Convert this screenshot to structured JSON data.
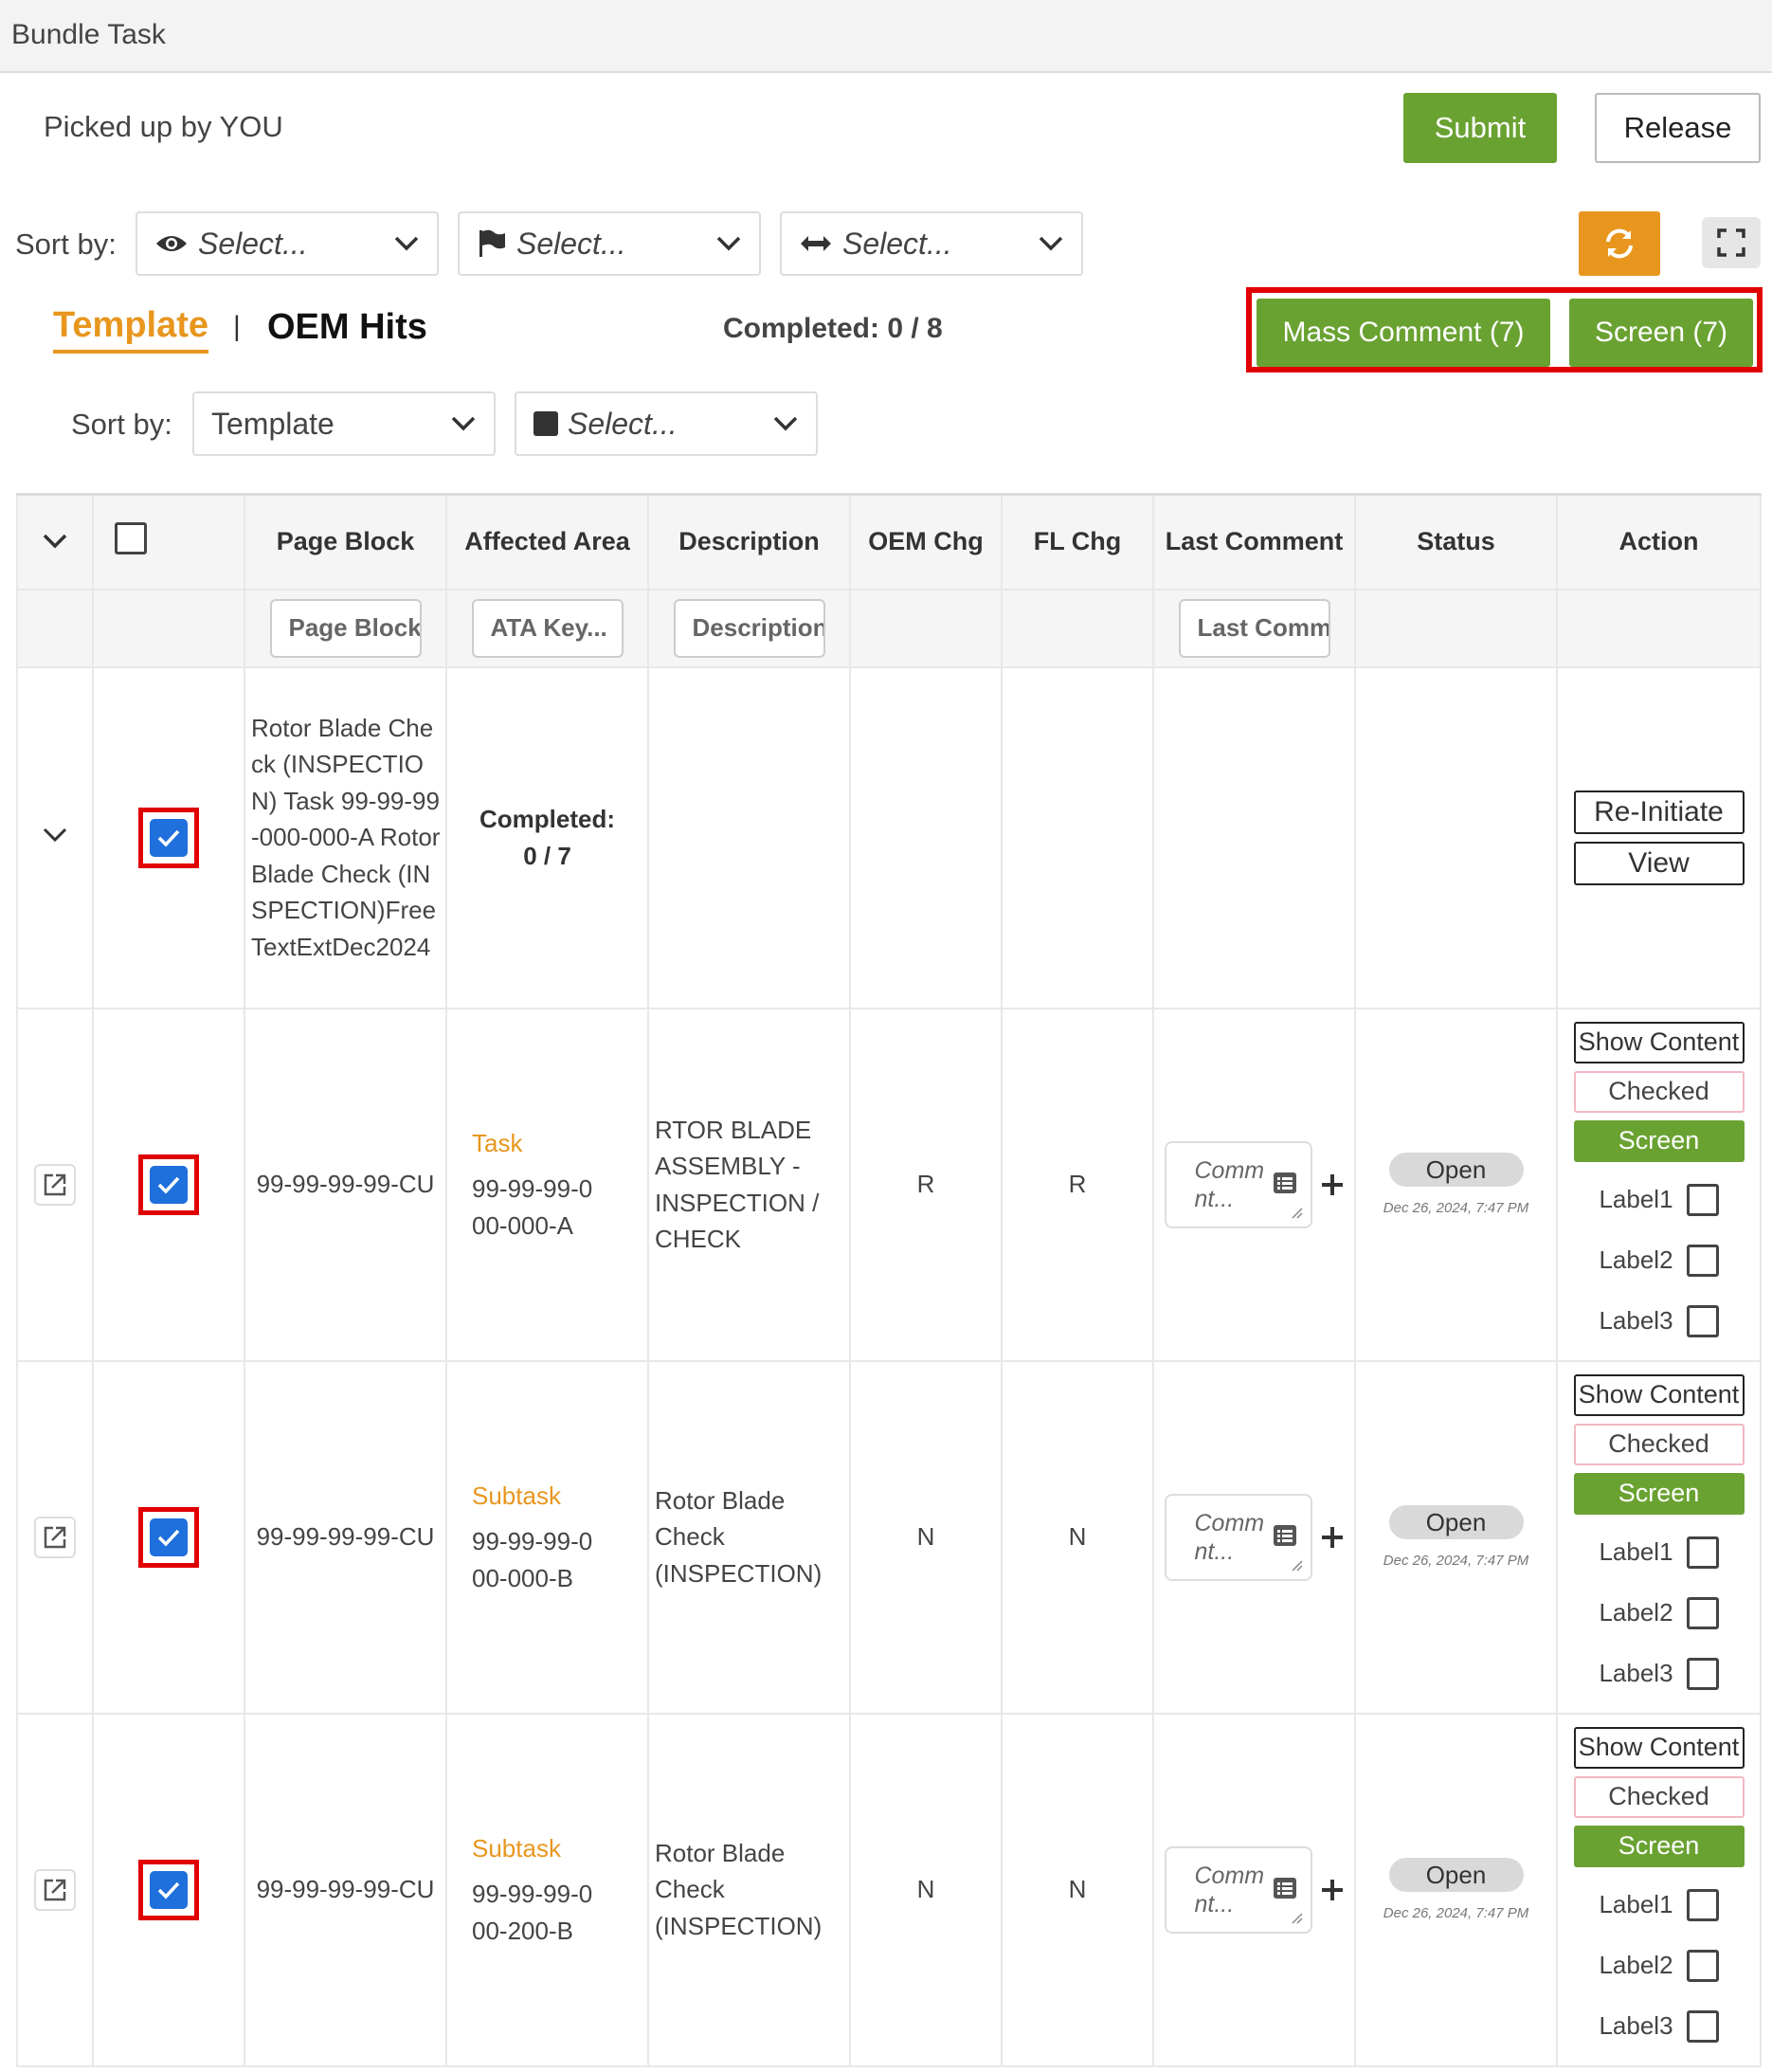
{
  "window": {
    "title": "Bundle Task"
  },
  "header": {
    "picked_up": "Picked up by YOU",
    "submit_label": "Submit",
    "release_label": "Release"
  },
  "sort1": {
    "label": "Sort by:",
    "select1": "Select...",
    "select2": "Select...",
    "select3": "Select..."
  },
  "tabs": {
    "template": "Template",
    "separator": "|",
    "oem_hits": "OEM Hits",
    "completed": "Completed: 0 / 8"
  },
  "mass": {
    "comment_label": "Mass Comment (7)",
    "screen_label": "Screen (7)"
  },
  "sort2": {
    "label": "Sort by:",
    "template_value": "Template",
    "select_placeholder": "Select..."
  },
  "columns": [
    "Page Block",
    "Affected Area",
    "Description",
    "OEM Chg",
    "FL Chg",
    "Last Comment",
    "Status",
    "Action"
  ],
  "filters": {
    "page_block": "Page Block",
    "ata_key": "ATA Key...",
    "description": "Description",
    "last_comment": "Last Comm"
  },
  "parent_row": {
    "page_block": "Rotor Blade Check (INSPECTION) Task 99-99-99-000-000-A Rotor Blade Check (INSPECTION)FreeTextExtDec2024",
    "completed": "Completed:",
    "completed_value": "0 / 7",
    "reinitiate_label": "Re-Initiate",
    "view_label": "View"
  },
  "rows": [
    {
      "page_block": "99-99-99-99-CU",
      "type": "Task",
      "ata": "99-99-99-000-000-A",
      "description": "RTOR BLADE ASSEMBLY - INSPECTION / CHECK",
      "oem_chg": "R",
      "fl_chg": "R",
      "comment_placeholder": "Comment...",
      "comment_text": "Comm nt...",
      "status": "Open",
      "timestamp": "Dec 26, 2024, 7:47 PM"
    },
    {
      "page_block": "99-99-99-99-CU",
      "type": "Subtask",
      "ata": "99-99-99-000-000-B",
      "description": "Rotor Blade Check (INSPECTION)",
      "oem_chg": "N",
      "fl_chg": "N",
      "comment_placeholder": "Comment...",
      "comment_text": "Comm nt...",
      "status": "Open",
      "timestamp": "Dec 26, 2024, 7:47 PM"
    },
    {
      "page_block": "99-99-99-99-CU",
      "type": "Subtask",
      "ata": "99-99-99-000-200-B",
      "description": "Rotor Blade Check (INSPECTION)",
      "oem_chg": "N",
      "fl_chg": "N",
      "comment_placeholder": "Comment...",
      "comment_text": "Comm nt...",
      "status": "Open",
      "timestamp": "Dec 26, 2024, 7:47 PM"
    }
  ],
  "actions": {
    "show_content": "Show Content",
    "checked": "Checked",
    "screen": "Screen",
    "label1": "Label1",
    "label2": "Label2",
    "label3": "Label3"
  },
  "colors": {
    "green": "#6aa232",
    "orange": "#e8961e",
    "refresh_orange": "#e8961e",
    "highlight_red": "#e00000",
    "checkbox_blue": "#1f6fdc"
  }
}
